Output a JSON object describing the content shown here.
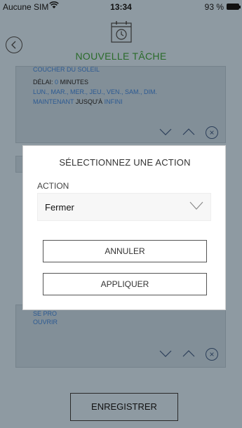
{
  "status_bar": {
    "carrier": "Aucune SIM",
    "time": "13:34",
    "battery": "93 %"
  },
  "header": {
    "title": "NOUVELLE TÂCHE"
  },
  "task_card_1": {
    "partial_line": "COUCHER DU SOLEIL",
    "delay_label": "DÉLAI:",
    "delay_value": "0",
    "delay_unit": "MINUTES",
    "days": "LUN., MAR., MER., JEU., VEN., SAM., DIM.",
    "start": "MAINTENANT",
    "until": "JUSQU'À",
    "end": "INFINI"
  },
  "task_card_2": {
    "line1": "SE PRO",
    "line2": "OUVRIR"
  },
  "icons": {
    "down": "chevron-down-icon",
    "up": "chevron-up-icon",
    "delete": "close-circle-icon"
  },
  "footer": {
    "save_label": "ENREGISTRER"
  },
  "modal": {
    "title": "SÉLECTIONNEZ UNE ACTION",
    "field_label": "ACTION",
    "selected_value": "Fermer",
    "cancel_label": "ANNULER",
    "apply_label": "APPLIQUER"
  }
}
